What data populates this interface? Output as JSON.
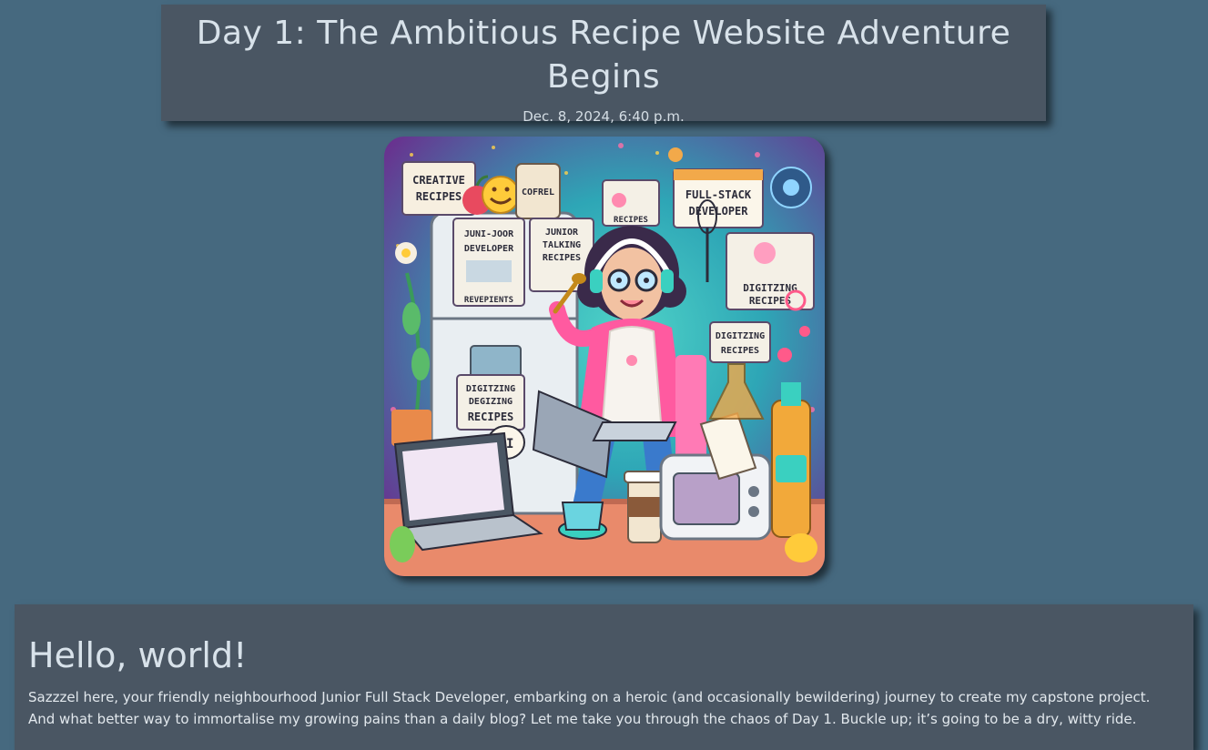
{
  "post": {
    "title": "Day 1: The Ambitious Recipe Website Adventure Begins",
    "date": "Dec. 8, 2024, 6:40 p.m."
  },
  "hero_image": {
    "labels": {
      "creative": "CREATIVE",
      "recipes_1": "RECIPES",
      "coffee": "COFREL",
      "junior_dev_1": "JUNI-JOOR",
      "junior_dev_2": "DEVELOPER",
      "junior_talk_1": "JUNIOR",
      "junior_talk_2": "TALKING",
      "junior_talk_3": "RECIPES",
      "revepients": "REVEPIENTS",
      "recipes_small": "RECIPES",
      "fullstack_1": "FULL-STACK",
      "fullstack_2": "DEVELOPER",
      "digitizing_a1": "DIGITZING",
      "digitizing_a2": "RECIPES",
      "digitizing_b1": "DIGITZING",
      "digitizing_b2": "RECIPES",
      "digitizing_c1": "DIGITZING",
      "digitizing_c2": "DEGIZING",
      "digitizing_c3": "RECIPES",
      "ai": "AI"
    }
  },
  "content": {
    "heading": "Hello, world!",
    "body": "Sazzzel here, your friendly neighbourhood Junior Full Stack Developer, embarking on a heroic (and occasionally bewildering) journey to create my capstone project. And what better way to immortalise my growing pains than a daily blog? Let me take you through the chaos of Day 1. Buckle up; it’s going to be a dry, witty ride."
  },
  "colors": {
    "page_background": "#46697f",
    "card_background": "#4a5663",
    "text": "#d8e2ea"
  }
}
